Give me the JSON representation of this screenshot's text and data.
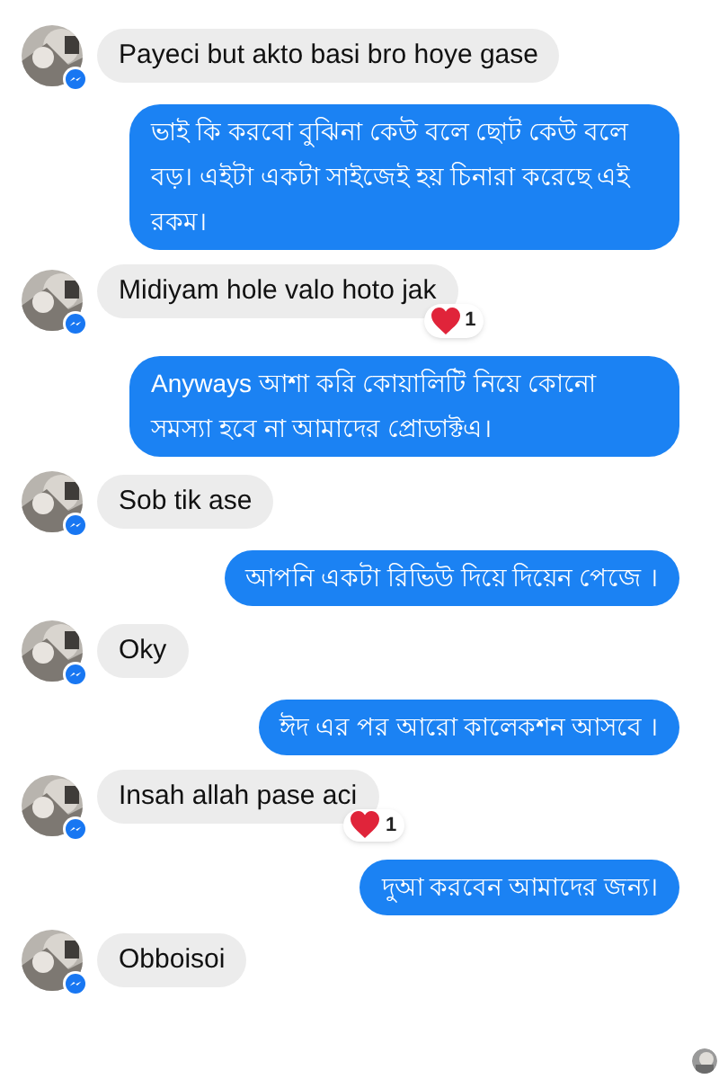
{
  "messages": [
    {
      "kind": "incoming",
      "text": "Payeci but akto basi bro hoye gase"
    },
    {
      "kind": "outgoing",
      "text": "ভাই কি করবো বুঝিনা কেউ বলে ছোট কেউ বলে বড়। এইটা একটা সাইজেই হয় চিনারা করেছে এই রকম।"
    },
    {
      "kind": "incoming",
      "text": "Midiyam hole valo hoto jak",
      "reaction": {
        "count": "1"
      }
    },
    {
      "kind": "outgoing",
      "text": "Anyways আশা করি কোয়ালিটি নিয়ে কোনো সমস্যা হবে না আমাদের  প্রোডাক্টএ।"
    },
    {
      "kind": "incoming",
      "text": "Sob tik ase"
    },
    {
      "kind": "outgoing",
      "text": "আপনি একটা রিভিউ দিয়ে দিয়েন পেজে ।"
    },
    {
      "kind": "incoming",
      "text": "Oky"
    },
    {
      "kind": "outgoing",
      "text": "ঈদ এর পর আরো কালেকশন আসবে ।"
    },
    {
      "kind": "incoming",
      "text": "Insah allah pase aci",
      "reaction": {
        "count": "1"
      }
    },
    {
      "kind": "outgoing",
      "text": "দুআ করবেন আমাদের জন্য।"
    },
    {
      "kind": "incoming",
      "text": "Obboisoi"
    }
  ]
}
